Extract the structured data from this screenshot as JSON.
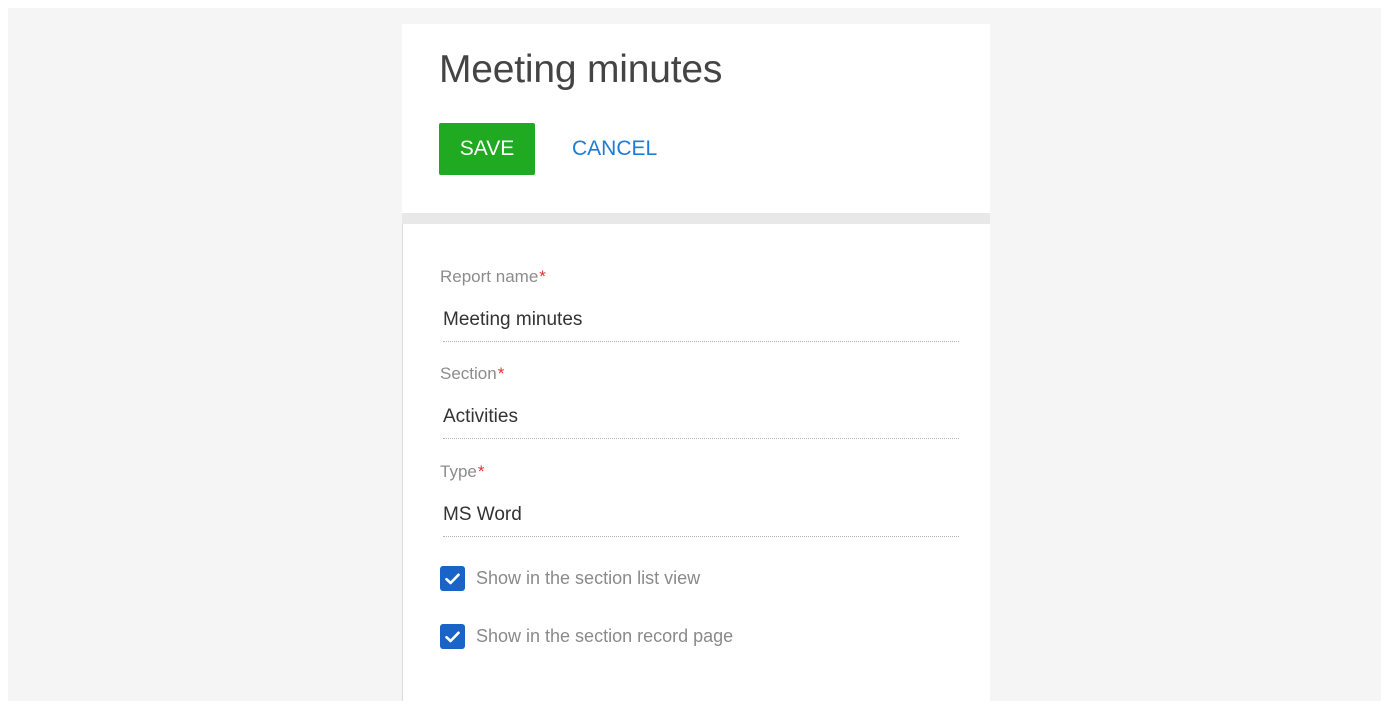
{
  "page": {
    "title": "Meeting minutes"
  },
  "toolbar": {
    "save_label": "SAVE",
    "cancel_label": "CANCEL"
  },
  "form": {
    "report_name": {
      "label": "Report name",
      "required_mark": "*",
      "value": "Meeting minutes"
    },
    "section": {
      "label": "Section",
      "required_mark": "*",
      "value": "Activities"
    },
    "type": {
      "label": "Type",
      "required_mark": "*",
      "value": "MS Word"
    },
    "checkboxes": [
      {
        "label": "Show in the section list view",
        "checked": true
      },
      {
        "label": "Show in the section record page",
        "checked": true
      }
    ]
  },
  "colors": {
    "save_button": "#1faa22",
    "cancel_link": "#1c7dd8",
    "checkbox": "#1a64c8",
    "required_star": "#e0322e"
  },
  "icons": {
    "checkmark": "checkmark-icon"
  }
}
